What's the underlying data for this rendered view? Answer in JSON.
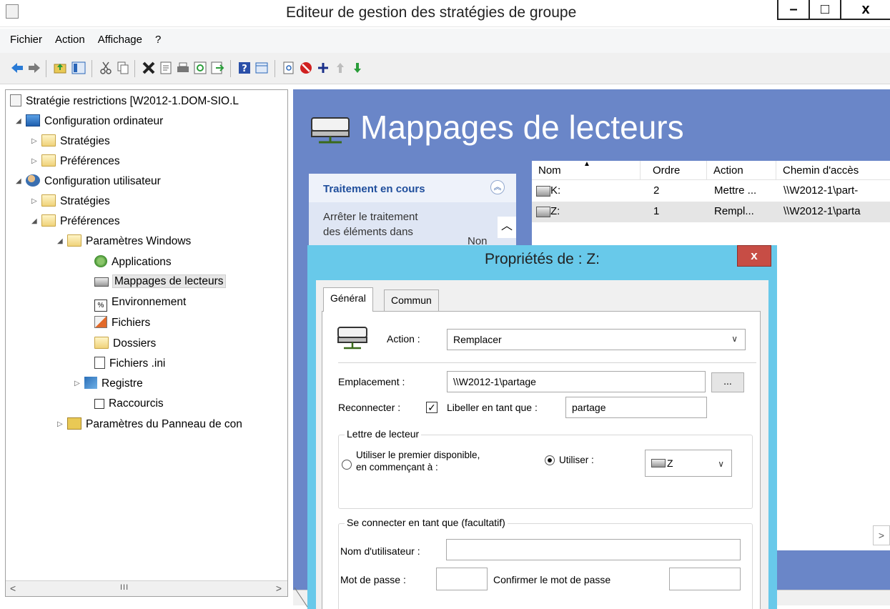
{
  "window": {
    "title": "Editeur de gestion des stratégies de groupe",
    "minimize": "–",
    "maximize": "□",
    "close": "x"
  },
  "menu": [
    "Fichier",
    "Action",
    "Affichage",
    "?"
  ],
  "tree": {
    "root": "Stratégie restrictions [W2012-1.DOM-SIO.L",
    "computer_config": "Configuration ordinateur",
    "strategies_1": "Stratégies",
    "preferences_1": "Préférences",
    "user_config": "Configuration utilisateur",
    "strategies_2": "Stratégies",
    "preferences_2": "Préférences",
    "windows_params": "Paramètres Windows",
    "items": [
      "Applications",
      "Mappages de lecteurs",
      "Environnement",
      "Fichiers",
      "Dossiers",
      "Fichiers .ini",
      "Registre",
      "Raccourcis"
    ],
    "control_panel": "Paramètres du Panneau de con",
    "scroll_thumb": "III"
  },
  "main": {
    "title": "Mappages de lecteurs",
    "processing": {
      "header": "Traitement en cours",
      "line1": "Arrêter le traitement",
      "line2": "des éléments dans",
      "value": "Non"
    },
    "columns": [
      "Nom",
      "Ordre",
      "Action",
      "Chemin d'accès"
    ],
    "rows": [
      {
        "name": "K:",
        "order": "2",
        "action": "Mettre ...",
        "path": "\\\\W2012-1\\part-"
      },
      {
        "name": "Z:",
        "order": "1",
        "action": "Rempl...",
        "path": "\\\\W2012-1\\parta"
      }
    ]
  },
  "dialog": {
    "title": "Propriétés de : Z:",
    "close": "x",
    "tabs": [
      "Général",
      "Commun"
    ],
    "action_label": "Action :",
    "action_value": "Remplacer",
    "location_label": "Emplacement :",
    "location_value": "\\\\W2012-1\\partage",
    "browse": "...",
    "reconnect_label": "Reconnecter :",
    "label_as": "Libeller en tant que :",
    "label_as_value": "partage",
    "drive_letter_group": "Lettre de lecteur",
    "use_first_line1": "Utiliser le premier disponible,",
    "use_first_line2": "en commençant à :",
    "use_label": "Utiliser :",
    "drive_value": "Z",
    "connect_as_group": "Se connecter en tant que (facultatif)",
    "username_label": "Nom d'utilisateur :",
    "password_label": "Mot de passe :",
    "confirm_label": "Confirmer le mot de passe"
  }
}
